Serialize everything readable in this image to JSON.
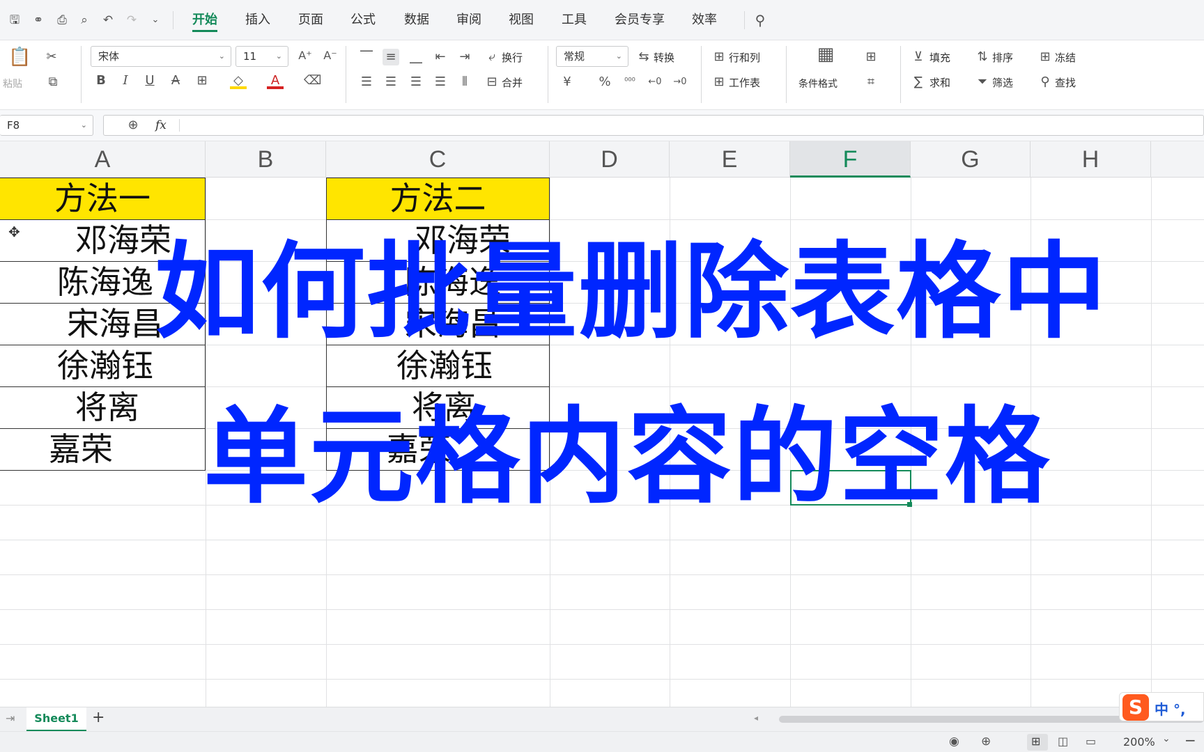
{
  "menu": {
    "tabs": [
      "开始",
      "插入",
      "页面",
      "公式",
      "数据",
      "审阅",
      "视图",
      "工具",
      "会员专享",
      "效率"
    ],
    "active_tab": "开始"
  },
  "ribbon": {
    "paste_label": "粘贴",
    "font_name": "宋体",
    "font_size": "11",
    "wrap_label": "换行",
    "merge_label": "合并",
    "number_format": "常规",
    "convert_label": "转换",
    "rowcol_label": "行和列",
    "worksheet_label": "工作表",
    "cond_format_label": "条件格式",
    "fill_label": "填充",
    "sort_label": "排序",
    "freeze_label": "冻结",
    "sum_label": "求和",
    "filter_label": "筛选",
    "find_label": "查找",
    "currency_symbol": "¥",
    "percent_symbol": "%"
  },
  "formula_bar": {
    "name_box": "F8",
    "fx_label": "fx",
    "formula": ""
  },
  "columns": [
    "A",
    "B",
    "C",
    "D",
    "E",
    "F",
    "G",
    "H"
  ],
  "selected_column": "F",
  "sheet": {
    "col_a_header": "方法一",
    "col_a_values": [
      "邓海荣",
      "陈海逸",
      "宋海昌",
      "徐瀚钰",
      "将离",
      "嘉荣"
    ],
    "col_c_header": "方法二",
    "col_c_values": [
      "邓海荣",
      "陈海逸",
      "宋海昌",
      "徐瀚钰",
      "将离",
      "嘉荣"
    ]
  },
  "overlay": {
    "line1": "如何批量删除表格中",
    "line2": "单元格内容的空格",
    "color": "#0026ff"
  },
  "sheet_tabs": {
    "active": "Sheet1",
    "add_label": "+"
  },
  "status": {
    "zoom": "200%"
  },
  "ime": {
    "label": "中 °,"
  }
}
